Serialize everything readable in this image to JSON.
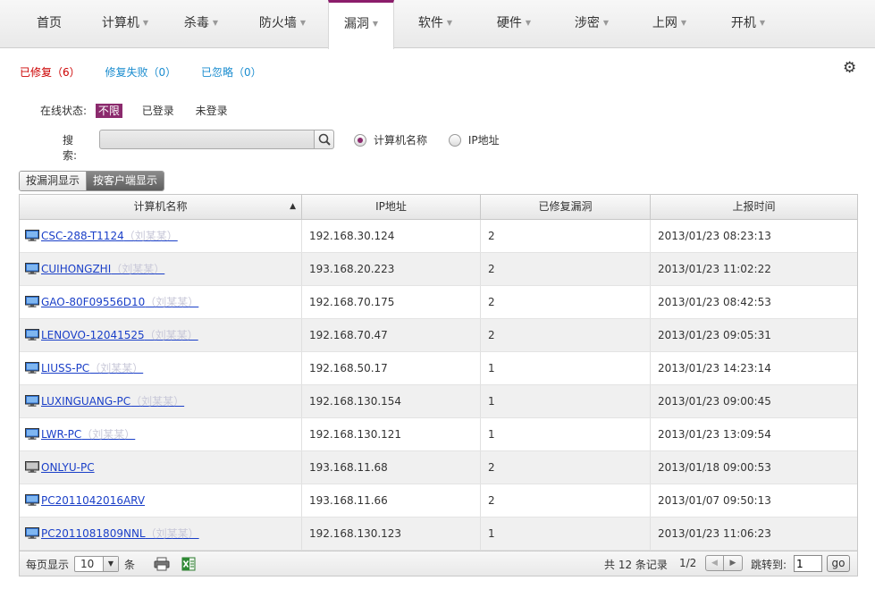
{
  "nav": [
    {
      "label": "首页",
      "dropdown": false,
      "active": false
    },
    {
      "label": "计算机",
      "dropdown": true,
      "active": false
    },
    {
      "label": "杀毒",
      "dropdown": true,
      "active": false
    },
    {
      "label": "防火墙",
      "dropdown": true,
      "active": false
    },
    {
      "label": "漏洞",
      "dropdown": true,
      "active": true
    },
    {
      "label": "软件",
      "dropdown": true,
      "active": false
    },
    {
      "label": "硬件",
      "dropdown": true,
      "active": false
    },
    {
      "label": "涉密",
      "dropdown": true,
      "active": false
    },
    {
      "label": "上网",
      "dropdown": true,
      "active": false
    },
    {
      "label": "开机",
      "dropdown": true,
      "active": false
    }
  ],
  "status_tabs": {
    "fixed": "已修复（6）",
    "failed": "修复失败（0）",
    "ignored": "已忽略（0）"
  },
  "filter": {
    "online_label": "在线状态:",
    "online_options": [
      "不限",
      "已登录",
      "未登录"
    ],
    "online_selected": "不限",
    "search_label": "搜索:",
    "search_value": "",
    "search_placeholder": "",
    "search_by_options": [
      "计算机名称",
      "IP地址"
    ],
    "search_by_selected": "计算机名称"
  },
  "view_toggle": {
    "by_vuln": "按漏洞显示",
    "by_client": "按客户端显示",
    "selected": "按客户端显示"
  },
  "table": {
    "columns": [
      "计算机名称",
      "IP地址",
      "已修复漏洞",
      "上报时间"
    ],
    "sorted_column": "计算机名称",
    "sort_direction": "asc",
    "rows": [
      {
        "name": "CSC-288-T1124",
        "user": "（刘某某）",
        "ip": "192.168.30.124",
        "fixed": "2",
        "time": "2013/01/23 08:23:13",
        "online": true
      },
      {
        "name": "CUIHONGZHI",
        "user": "（刘某某）",
        "ip": "193.168.20.223",
        "fixed": "2",
        "time": "2013/01/23 11:02:22",
        "online": true
      },
      {
        "name": "GAO-80F09556D10",
        "user": "（刘某某）",
        "ip": "192.168.70.175",
        "fixed": "2",
        "time": "2013/01/23 08:42:53",
        "online": true
      },
      {
        "name": "LENOVO-12041525",
        "user": "（刘某某）",
        "ip": "192.168.70.47",
        "fixed": "2",
        "time": "2013/01/23 09:05:31",
        "online": true
      },
      {
        "name": "LIUSS-PC",
        "user": "（刘某某）",
        "ip": "192.168.50.17",
        "fixed": "1",
        "time": "2013/01/23 14:23:14",
        "online": true
      },
      {
        "name": "LUXINGUANG-PC",
        "user": "（刘某某）",
        "ip": "192.168.130.154",
        "fixed": "1",
        "time": "2013/01/23 09:00:45",
        "online": true
      },
      {
        "name": "LWR-PC",
        "user": "（刘某某）",
        "ip": "192.168.130.121",
        "fixed": "1",
        "time": "2013/01/23 13:09:54",
        "online": true
      },
      {
        "name": "ONLYU-PC",
        "user": "",
        "ip": "193.168.11.68",
        "fixed": "2",
        "time": "2013/01/18 09:00:53",
        "online": false
      },
      {
        "name": "PC2011042016ARV",
        "user": "",
        "ip": "193.168.11.66",
        "fixed": "2",
        "time": "2013/01/07 09:50:13",
        "online": true
      },
      {
        "name": "PC2011081809NNL",
        "user": "（刘某某）",
        "ip": "192.168.130.123",
        "fixed": "1",
        "time": "2013/01/23 11:06:23",
        "online": true
      }
    ]
  },
  "footer": {
    "per_page_label": "每页显示",
    "per_page_value": "10",
    "per_page_unit": "条",
    "total_text": "共 12 条记录",
    "page_text": "1/2",
    "jump_label": "跳转到:",
    "jump_value": "1",
    "go_label": "go"
  },
  "icons": {
    "gear": "gear-icon",
    "search": "magnifier-icon",
    "computer_online": "monitor-blue-icon",
    "computer_offline": "monitor-gray-icon",
    "print": "printer-icon",
    "excel": "excel-icon"
  },
  "colors": {
    "accent": "#8b2a6d",
    "link": "#1a3fc8",
    "status_fixed": "#cc0000",
    "status_other": "#1a8ccf"
  }
}
